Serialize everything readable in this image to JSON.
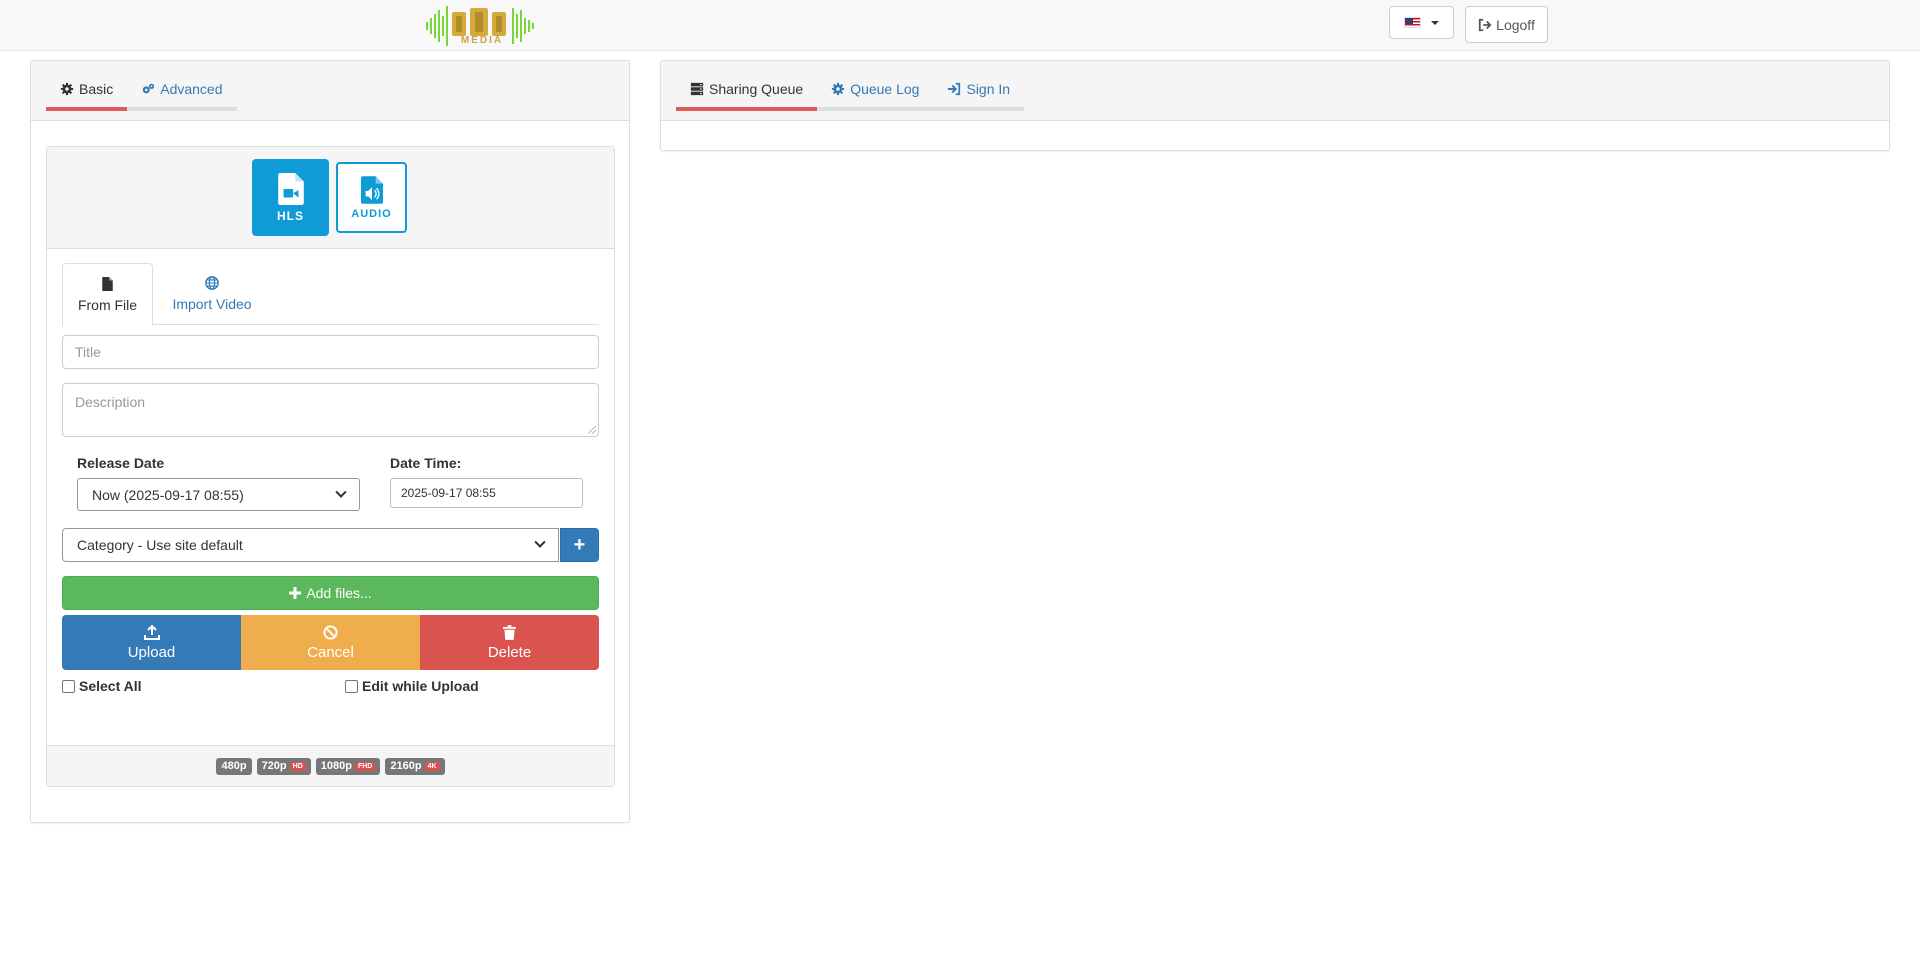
{
  "header": {
    "logo_word": "MEDIA",
    "language_flag": "us-flag-icon",
    "logoff_label": "Logoff"
  },
  "left_panel": {
    "tabs": [
      {
        "label": "Basic",
        "icon": "gear-icon",
        "active": true
      },
      {
        "label": "Advanced",
        "icon": "gears-icon",
        "active": false
      }
    ]
  },
  "right_panel": {
    "tabs": [
      {
        "label": "Sharing Queue",
        "icon": "server-icon",
        "active": true
      },
      {
        "label": "Queue Log",
        "icon": "gear-icon",
        "active": false
      },
      {
        "label": "Sign In",
        "icon": "sign-in-icon",
        "active": false
      }
    ]
  },
  "upload": {
    "types": [
      {
        "label": "HLS",
        "icon": "file-video-icon",
        "active": true
      },
      {
        "label": "AUDIO",
        "icon": "file-audio-icon",
        "active": false
      }
    ],
    "source_tabs": [
      {
        "label": "From File",
        "icon": "file-icon",
        "active": true
      },
      {
        "label": "Import Video",
        "icon": "globe-icon",
        "active": false
      }
    ],
    "title_placeholder": "Title",
    "description_placeholder": "Description",
    "release_date_label": "Release Date",
    "release_date_value": "Now (2025-09-17 08:55)",
    "date_time_label": "Date Time:",
    "date_time_value": "2025-09-17 08:55",
    "category_value": "Category - Use site default",
    "add_category_label": "+",
    "add_files_label": "Add files...",
    "actions": {
      "upload": "Upload",
      "cancel": "Cancel",
      "delete": "Delete"
    },
    "select_all_label": "Select All",
    "edit_while_upload_label": "Edit while Upload",
    "resolutions": [
      {
        "label": "480p",
        "tag": ""
      },
      {
        "label": "720p",
        "tag": "HD"
      },
      {
        "label": "1080p",
        "tag": "FHD"
      },
      {
        "label": "2160p",
        "tag": "4K"
      }
    ]
  },
  "colors": {
    "primary": "#337ab7",
    "success": "#5cb85c",
    "warning": "#f0ad4e",
    "danger": "#d9534f",
    "hls_blue": "#0e9bd6",
    "tab_active_border": "#e05a5a"
  }
}
